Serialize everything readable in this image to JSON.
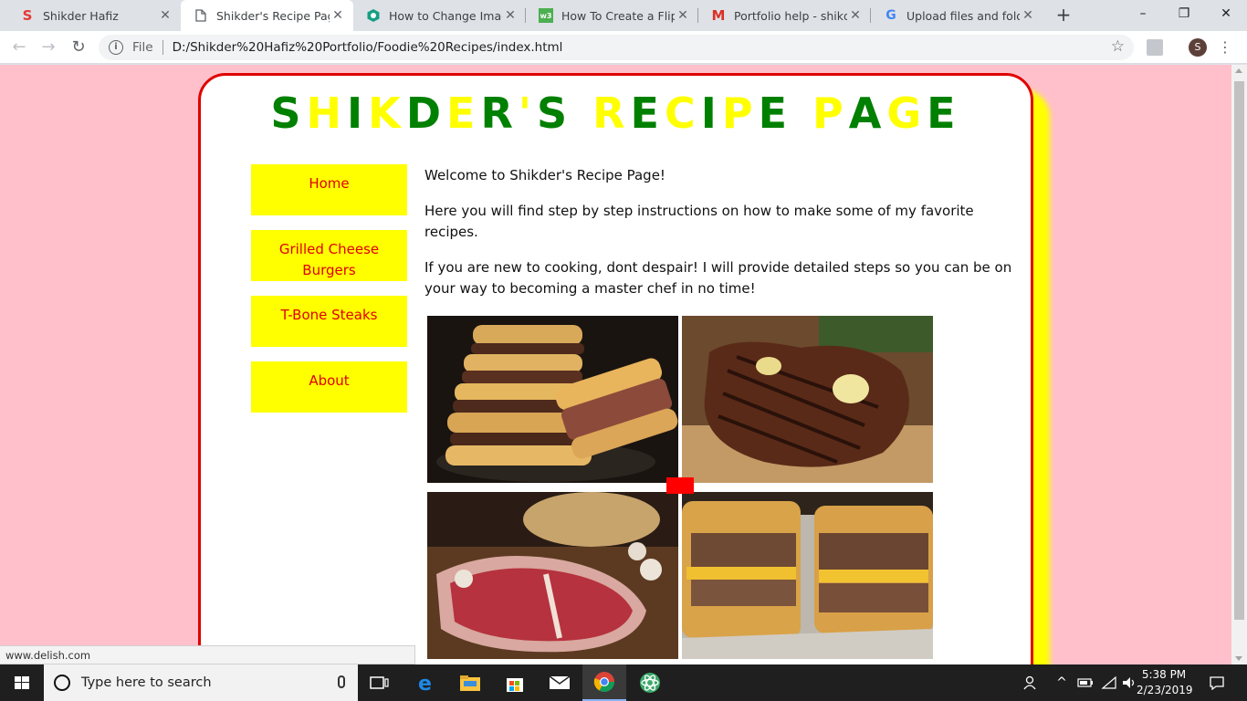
{
  "browser": {
    "tabs": [
      {
        "label": "Shikder Hafiz",
        "favicon": "s-logo-icon",
        "color": "#e53935",
        "active": false
      },
      {
        "label": "Shikder's Recipe Page",
        "favicon": "document-icon",
        "color": "#5f6368",
        "active": true
      },
      {
        "label": "How to Change Image",
        "favicon": "hexagon-icon",
        "color": "#14a085",
        "active": false
      },
      {
        "label": "How To Create a Flip Ca",
        "favicon": "w3schools-icon",
        "color": "#4caf50",
        "active": false
      },
      {
        "label": "Portfolio help - shikder",
        "favicon": "gmail-icon",
        "color": "#d93025",
        "active": false
      },
      {
        "label": "Upload files and folders",
        "favicon": "google-icon",
        "color": "#4285f4",
        "active": false
      }
    ],
    "new_tab_glyph": "+",
    "window_controls": {
      "minimize": "–",
      "restore": "❐",
      "close": "✕"
    },
    "address": {
      "scheme": "File",
      "url": "D:/Shikder%20Hafiz%20Portfolio/Foodie%20Recipes/index.html"
    },
    "profile_initial": "S",
    "status_url": "www.delish.com"
  },
  "page": {
    "title": "SHIKDER'S RECIPE PAGE",
    "title_colors": [
      "#008000",
      "#ffff00"
    ],
    "nav": [
      {
        "label": "Home"
      },
      {
        "label": "Grilled Cheese Burgers"
      },
      {
        "label": "T-Bone Steaks"
      },
      {
        "label": "About"
      }
    ],
    "paragraphs": [
      "Welcome to Shikder's Recipe Page!",
      "Here you will find step by step instructions on how to make some of my favorite recipes.",
      "If you are new to cooking, dont despair! I will provide detailed steps so you can be on your way to becoming a master chef in no time!"
    ],
    "photos": [
      {
        "name": "grilled-cheese-burger-stack-photo"
      },
      {
        "name": "grilled-t-bone-steak-photo"
      },
      {
        "name": "raw-t-bone-steak-photo"
      },
      {
        "name": "grilled-cheese-burger-cut-photo"
      }
    ],
    "colors": {
      "background": "#ffc0cb",
      "border": "#e00000",
      "nav_bg": "#ffff00",
      "nav_text": "#e00000",
      "shadow": "#ffff00"
    }
  },
  "taskbar": {
    "search_placeholder": "Type here to search",
    "time": "5:38 PM",
    "date": "2/23/2019"
  }
}
